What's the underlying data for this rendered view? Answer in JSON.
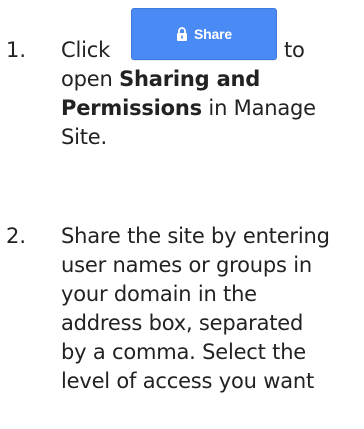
{
  "steps": [
    {
      "number": "1.",
      "click": "Click",
      "button_label": "Share",
      "to": "to",
      "line2_pre": "open ",
      "line2_bold": "Sharing and",
      "line3_bold": "Permissions",
      "line3_post": " in Manage",
      "line4": "Site."
    },
    {
      "number": "2.",
      "lines": [
        "Share the site by entering",
        "user names or groups in",
        "your domain in the",
        "address box, separated",
        "by a comma. Select the",
        "level of access you want"
      ]
    }
  ],
  "colors": {
    "button_bg": "#4a8af4",
    "text": "#222222"
  },
  "icons": {
    "share_button": "lock-icon"
  }
}
